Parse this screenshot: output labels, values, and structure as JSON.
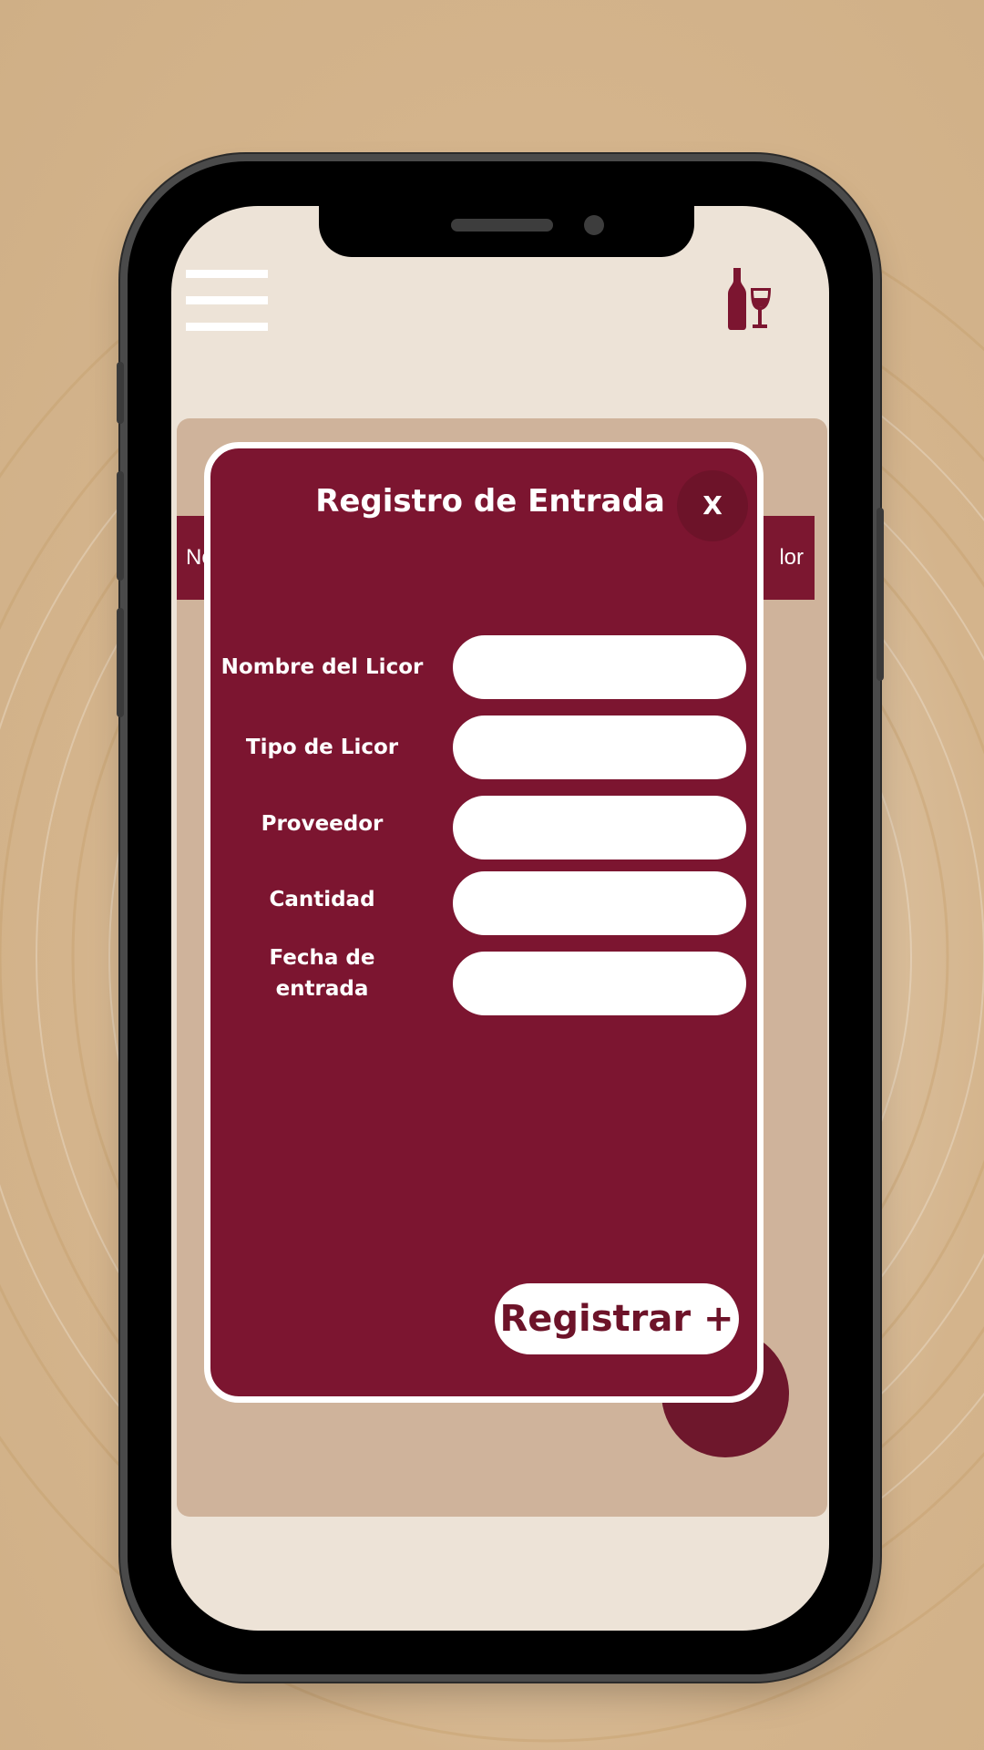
{
  "colors": {
    "wine": "#7c1530",
    "wine_dark": "#6d1329",
    "cream": "#ede3d7",
    "panel_tan": "#cfb39b",
    "white": "#ffffff"
  },
  "app_bar": {
    "menu_icon": "hamburger-menu-icon",
    "logo_icon": "wine-bottle-glass-icon"
  },
  "background_table": {
    "header_left_partial": "No",
    "header_right_partial": "lor"
  },
  "modal": {
    "title": "Registro de Entrada",
    "close_label": "X",
    "fields": [
      {
        "label": "Nombre del Licor",
        "value": "",
        "placeholder": ""
      },
      {
        "label": "Tipo de Licor",
        "value": "",
        "placeholder": ""
      },
      {
        "label": "Proveedor",
        "value": "",
        "placeholder": ""
      },
      {
        "label": "Cantidad",
        "value": "",
        "placeholder": ""
      },
      {
        "label_line1": "Fecha de",
        "label_line2": "entrada",
        "value": "",
        "placeholder": ""
      }
    ],
    "submit_label": "Registrar +"
  }
}
